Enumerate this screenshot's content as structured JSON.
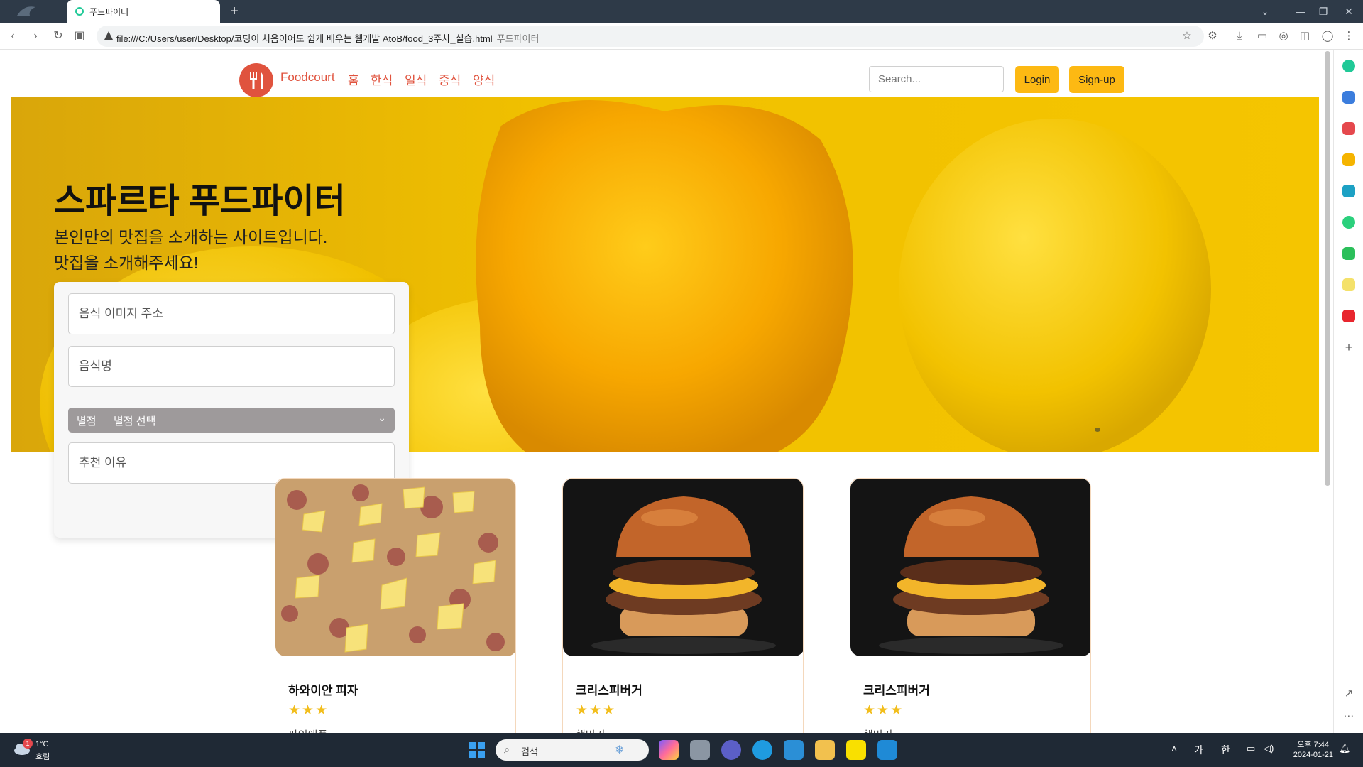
{
  "browser": {
    "tab_title": "푸드파이터",
    "url": "file:///C:/Users/user/Desktop/코딩이 처음이어도 쉽게 배우는 웹개발 AtoB/food_3주차_실습.html",
    "page_title": "푸드파이터"
  },
  "navbar": {
    "brand": "Foodcourt",
    "links": [
      "홈",
      "한식",
      "일식",
      "중식",
      "양식"
    ],
    "search_placeholder": "Search...",
    "login_label": "Login",
    "signup_label": "Sign-up"
  },
  "hero": {
    "title": "스파르타 푸드파이터",
    "subtitle_line1": "본인만의 맛집을 소개하는 사이트입니다.",
    "subtitle_line2": "맛집을 소개해주세요!"
  },
  "form": {
    "image_url_placeholder": "음식 이미지 주소",
    "food_name_placeholder": "음식명",
    "rating_label": "별점",
    "rating_value": "별점 선택",
    "reason_placeholder": "추천 이유"
  },
  "cards": [
    {
      "title": "하와이안 피자",
      "stars": "★★★",
      "desc": "파인애플",
      "image": "pizza"
    },
    {
      "title": "크리스피버거",
      "stars": "★★★",
      "desc": "햄버거",
      "image": "burger"
    },
    {
      "title": "크리스피버거",
      "stars": "★★★",
      "desc": "햄버거",
      "image": "burger"
    }
  ],
  "taskbar": {
    "weather_temp": "1°C",
    "weather_cond": "흐림",
    "weather_badge": "1",
    "search_label": "검색",
    "tray_lang1": "가",
    "tray_lang2": "한",
    "time": "오후 7:44",
    "date": "2024-01-21"
  },
  "colors": {
    "accent": "#e0533e",
    "button_yellow": "#fdb913",
    "hero_yellow": "#f0c000",
    "star": "#f2be1d"
  }
}
